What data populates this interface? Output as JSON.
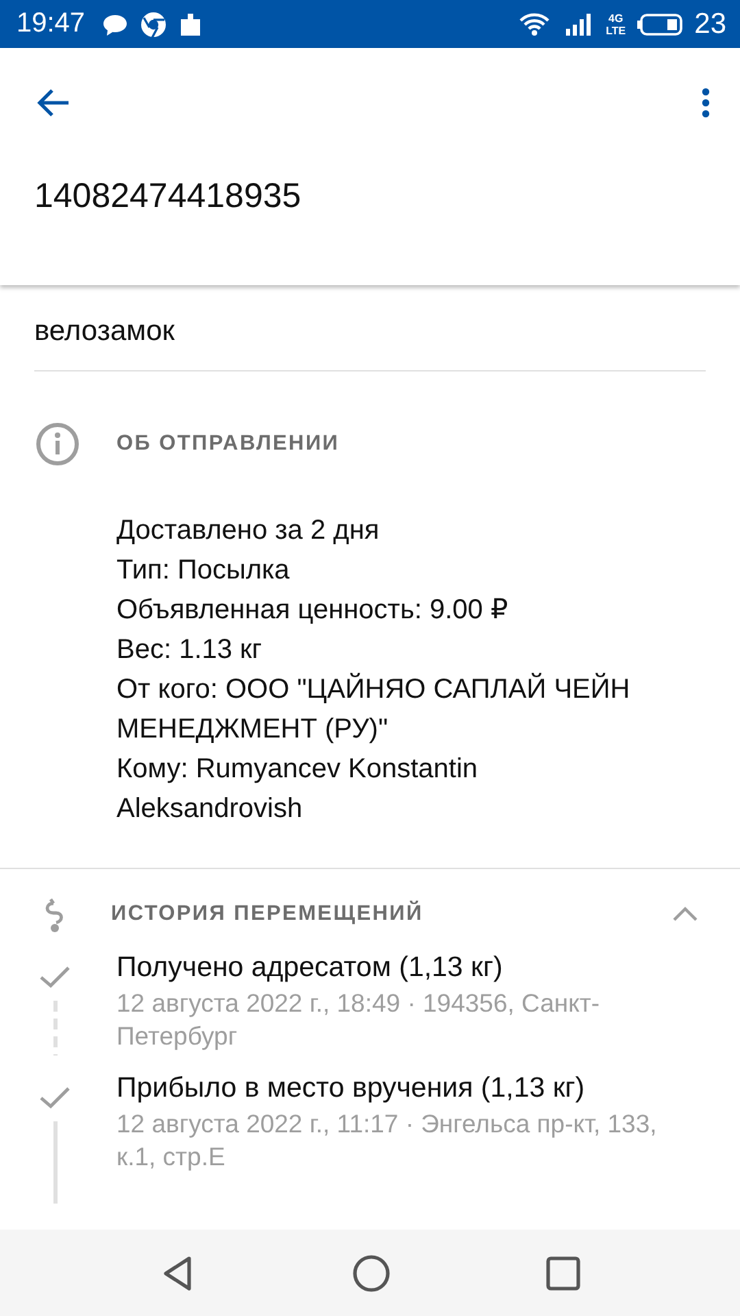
{
  "status_bar": {
    "time": "19:47",
    "network_top": "4G",
    "network_bottom": "LTE",
    "battery": "23"
  },
  "tracking_number": "14082474418935",
  "note": {
    "value": "велозамок"
  },
  "shipment_info": {
    "title": "ОБ ОТПРАВЛЕНИИ",
    "lines": [
      "Доставлено за 2 дня",
      "Тип: Посылка",
      "Объявленная ценность: 9.00 ₽",
      "Вес: 1.13 кг",
      "От кого: ООО \"ЦАЙНЯО САПЛАЙ ЧЕЙН МЕНЕДЖМЕНТ (РУ)\"",
      "Кому: Rumyancev Konstantin Aleksandrovish"
    ]
  },
  "history": {
    "title": "ИСТОРИЯ ПЕРЕМЕЩЕНИЙ",
    "expanded": true,
    "events": [
      {
        "title": "Получено адресатом (1,13 кг)",
        "meta": "12 августа 2022 г., 18:49 · 194356, Санкт-Петербург",
        "kind": "dashed"
      },
      {
        "title": "Прибыло в место вручения (1,13 кг)",
        "meta": "12 августа 2022 г., 11:17 · Энгельса пр-кт, 133, к.1, стр.Е",
        "kind": "solid"
      }
    ]
  }
}
